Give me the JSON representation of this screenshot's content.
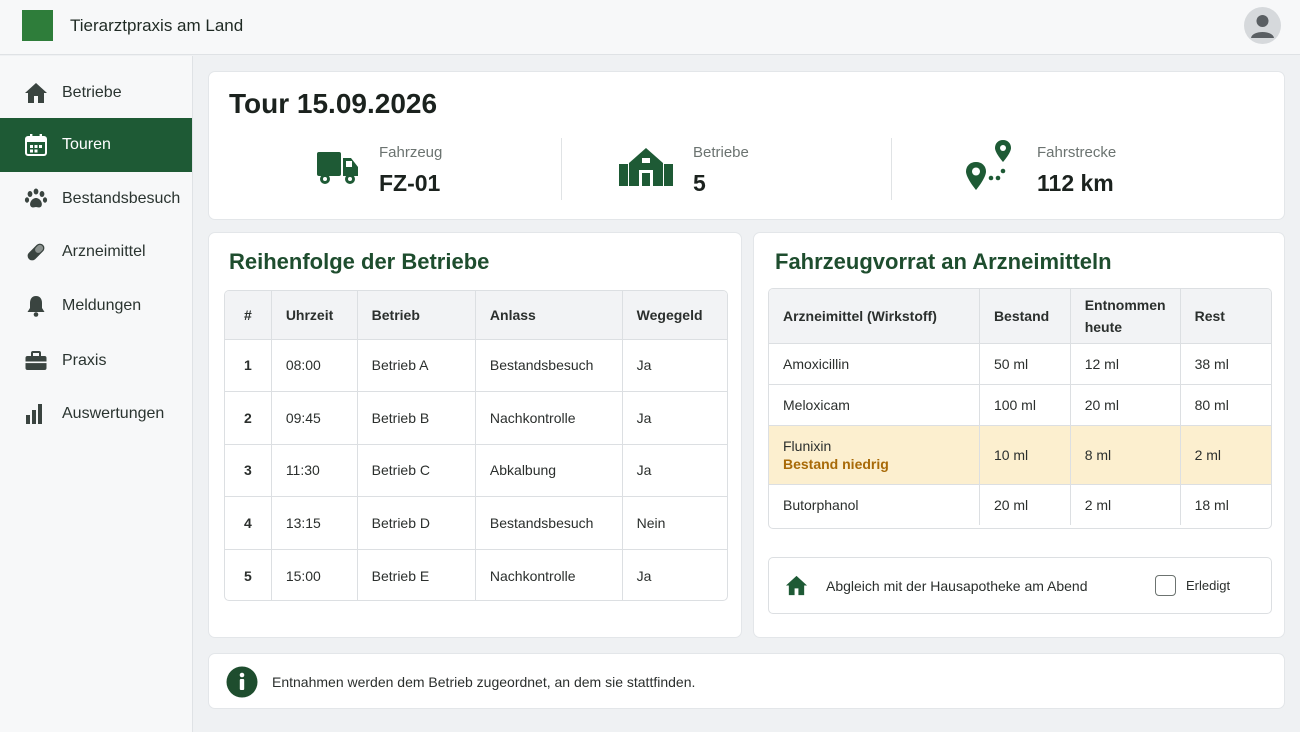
{
  "app": {
    "title": "Tierarztpraxis am Land"
  },
  "sidebar": {
    "items": [
      {
        "label": "Betriebe",
        "icon": "home-icon"
      },
      {
        "label": "Touren",
        "icon": "calendar-icon",
        "active": true
      },
      {
        "label": "Bestandsbesuch",
        "icon": "paw-icon"
      },
      {
        "label": "Arzneimittel",
        "icon": "pill-icon"
      },
      {
        "label": "Meldungen",
        "icon": "bell-icon"
      },
      {
        "label": "Praxis",
        "icon": "briefcase-icon"
      },
      {
        "label": "Auswertungen",
        "icon": "bar-chart-icon"
      }
    ]
  },
  "tour": {
    "title": "Tour 15.09.2026",
    "stats": [
      {
        "label": "Fahrzeug",
        "value": "FZ-01",
        "icon": "truck-icon"
      },
      {
        "label": "Betriebe",
        "value": "5",
        "icon": "farm-icon"
      },
      {
        "label": "Fahrstrecke",
        "value": "112 km",
        "icon": "route-icon"
      }
    ]
  },
  "order": {
    "title": "Reihenfolge der Betriebe",
    "columns": [
      "#",
      "Uhrzeit",
      "Betrieb",
      "Anlass",
      "Wegegeld"
    ],
    "rows": [
      [
        "1",
        "08:00",
        "Betrieb A",
        "Bestandsbesuch",
        "Ja"
      ],
      [
        "2",
        "09:45",
        "Betrieb B",
        "Nachkontrolle",
        "Ja"
      ],
      [
        "3",
        "11:30",
        "Betrieb C",
        "Abkalbung",
        "Ja"
      ],
      [
        "4",
        "13:15",
        "Betrieb D",
        "Bestandsbesuch",
        "Nein"
      ],
      [
        "5",
        "15:00",
        "Betrieb E",
        "Nachkontrolle",
        "Ja"
      ]
    ]
  },
  "stock": {
    "title": "Fahrzeugvorrat an Arzneimitteln",
    "columns": [
      "Arzneimittel (Wirkstoff)",
      "Bestand",
      "Entnommen heute",
      "Rest"
    ],
    "rows": [
      {
        "name": "Amoxicillin",
        "stock": "50 ml",
        "taken": "12 ml",
        "rest": "38 ml"
      },
      {
        "name": "Meloxicam",
        "stock": "100 ml",
        "taken": "20 ml",
        "rest": "80 ml"
      },
      {
        "name": "Flunixin",
        "note": "Bestand niedrig",
        "stock": "10 ml",
        "taken": "8 ml",
        "rest": "2 ml",
        "low": true
      },
      {
        "name": "Butorphanol",
        "stock": "20 ml",
        "taken": "2 ml",
        "rest": "18 ml"
      }
    ],
    "sync": {
      "text": "Abgleich mit der Hausapotheke am Abend",
      "checkbox_label": "Erledigt",
      "checked": false
    }
  },
  "info": {
    "text": "Entnahmen werden dem Betrieb zugeordnet, an dem sie stattfinden."
  },
  "colors": {
    "primary": "#1e5a35",
    "warning_bg": "#fcefcf",
    "warning_text": "#a86a08"
  }
}
